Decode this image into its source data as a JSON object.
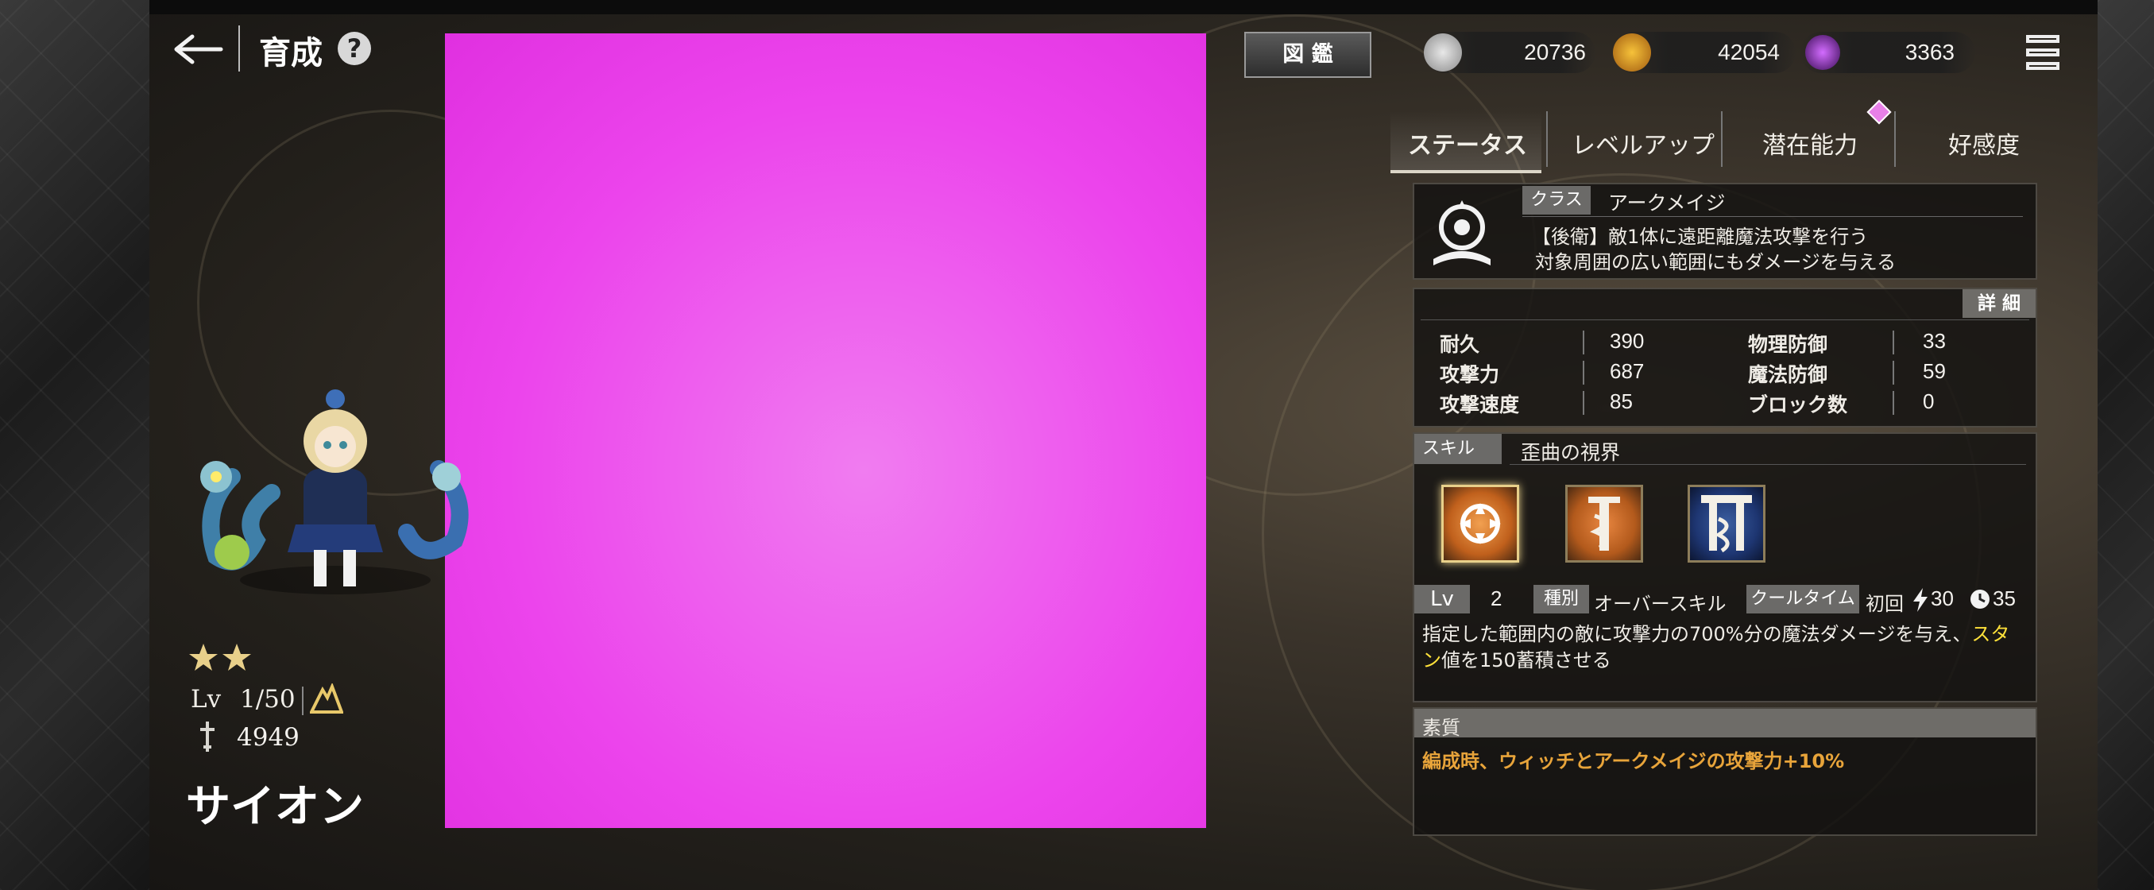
{
  "header": {
    "title": "育成",
    "back_icon": "back-arrow-icon",
    "help_icon": "question-icon",
    "encyclopedia_label": "図 鑑",
    "menu_icon": "menu-icon"
  },
  "currencies": [
    {
      "icon": "silver-coin-icon",
      "value": "20736"
    },
    {
      "icon": "gold-coin-icon",
      "value": "42054"
    },
    {
      "icon": "purple-gem-icon",
      "value": "3363"
    }
  ],
  "tabs": [
    {
      "label": "ステータス",
      "active": true
    },
    {
      "label": "レベルアップ",
      "active": false
    },
    {
      "label": "潜在能力",
      "active": false,
      "badge": "diamond-notification-icon"
    },
    {
      "label": "好感度",
      "active": false
    }
  ],
  "class_section": {
    "tag": "クラス",
    "name": "アークメイジ",
    "desc_line1": "【後衛】敵1体に遠距離魔法攻撃を行う",
    "desc_line2": "対象周囲の広い範囲にもダメージを与える",
    "icon": "arcmage-class-icon"
  },
  "detail_button": "詳 細",
  "stats": {
    "left": [
      {
        "label": "耐久",
        "value": "390"
      },
      {
        "label": "攻撃力",
        "value": "687"
      },
      {
        "label": "攻撃速度",
        "value": "85"
      }
    ],
    "right": [
      {
        "label": "物理防御",
        "value": "33"
      },
      {
        "label": "魔法防御",
        "value": "59"
      },
      {
        "label": "ブロック数",
        "value": "0"
      }
    ]
  },
  "skill": {
    "tag": "スキル",
    "name": "歪曲の視界",
    "icons": [
      "distortion-skill-icon",
      "serpent-staff-skill-icon",
      "serpent-gate-skill-icon"
    ],
    "lv_label": "Lv",
    "lv_value": "2",
    "type_label": "種別",
    "type_value": "オーバースキル",
    "cooldown_label": "クールタイム",
    "first_label": "初回",
    "first_value": "30",
    "cooldown_value": "35",
    "desc_part1": "指定した範囲内の敵に攻撃力の700%分の魔法ダメージを与え、",
    "desc_highlight_a": "スタ",
    "desc_highlight_b": "ン",
    "desc_part2": "値を150蓄積させる"
  },
  "trait": {
    "title": "素質",
    "text": "編成時、ウィッチとアークメイジの攻撃力+10%"
  },
  "character": {
    "stars": 2,
    "level_label": "Lv",
    "level": "1/50",
    "power": "4949",
    "name": "サイオン"
  },
  "colors": {
    "placeholder": "#ee44ee",
    "trait_text": "#e8a43a",
    "highlight": "#ffe13a",
    "panel_bg": "#121110",
    "header_bar": "#6e6c68"
  }
}
